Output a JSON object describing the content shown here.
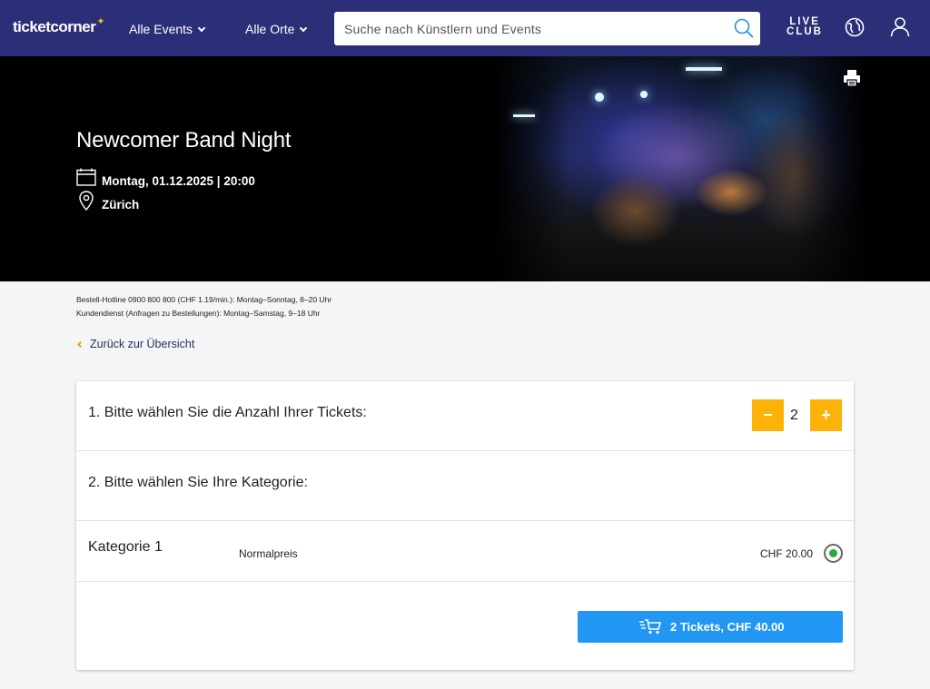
{
  "header": {
    "logo": "ticketcorner",
    "logo_star": "✦",
    "nav": [
      {
        "label": "Alle Events"
      },
      {
        "label": "Alle Orte"
      }
    ],
    "search": {
      "placeholder": "Suche nach Künstlern und Events",
      "value": ""
    },
    "live_club": [
      "LIVE",
      "CLUB"
    ],
    "icons": [
      "search-icon",
      "globe-icon",
      "user-icon",
      "print-icon"
    ]
  },
  "event": {
    "title": "Newcomer Band Night",
    "datetime": "Montag, 01.12.2025 | 20:00",
    "location": "Zürich"
  },
  "info": {
    "hotline": "Bestell-Hotline 0900 800 800 (CHF 1.19/min.): Montag–Sonntag, 8–20 Uhr",
    "service": "Kundendienst (Anfragen zu Bestellungen): Montag–Samstag, 9–18 Uhr"
  },
  "back_link": "Zurück zur Übersicht",
  "ticket_form": {
    "step1": "1. Bitte wählen Sie die Anzahl Ihrer Tickets:",
    "quantity": "2",
    "minus": "−",
    "plus": "+",
    "step2": "2. Bitte wählen Sie Ihre Kategorie:",
    "category": {
      "name": "Kategorie 1",
      "price_type": "Normalpreis",
      "price": "CHF 20.00",
      "selected": true
    },
    "submit": "2 Tickets, CHF 40.00"
  },
  "colors": {
    "header_bg": "#2b2f78",
    "accent_yellow": "#fbb30a",
    "cta_blue": "#2196f3",
    "radio_green": "#2aa845"
  }
}
